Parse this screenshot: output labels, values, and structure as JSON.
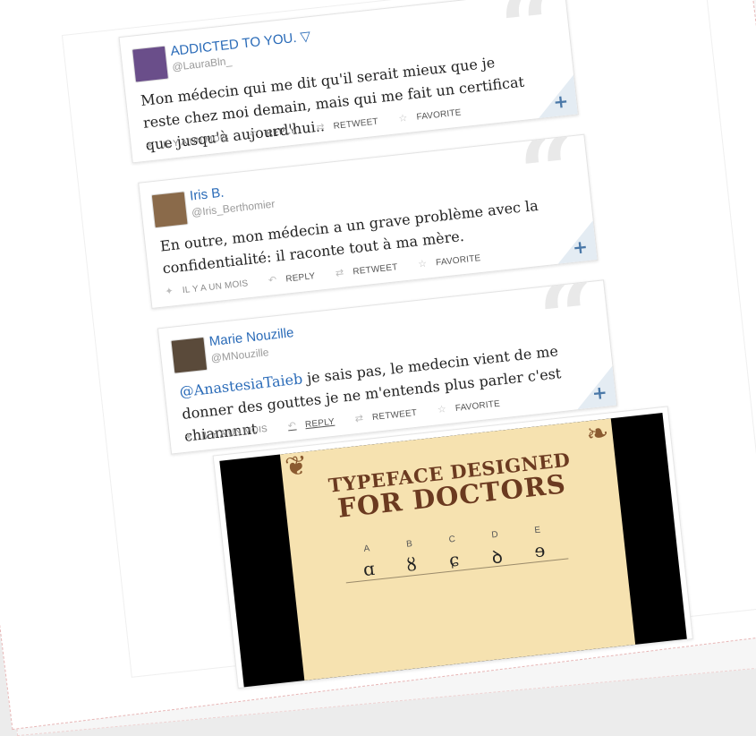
{
  "tweets": [
    {
      "name": "ADDICTED TO YOU. ▽",
      "handle": "@LauraBln_",
      "mention": "",
      "text": "Mon médecin qui me dit qu'il serait mieux que je reste chez moi demain, mais qui me fait un certificat que jusqu'à aujourd'hui..",
      "time": "IL Y A UN MOIS",
      "reply": "REPLY",
      "retweet": "RETWEET",
      "favorite": "FAVORITE",
      "avatar_color": "#6a4e8a"
    },
    {
      "name": "Iris B.",
      "handle": "@Iris_Berthomier",
      "mention": "",
      "text": "En outre, mon médecin a un grave problème avec la confidentialité: il raconte tout à ma mère.",
      "time": "IL Y A UN MOIS",
      "reply": "REPLY",
      "retweet": "RETWEET",
      "favorite": "FAVORITE",
      "avatar_color": "#8a6a4a"
    },
    {
      "name": "Marie Nouzille",
      "handle": "@MNouzille",
      "mention": "@AnastesiaTaieb",
      "text": " je sais pas, le medecin vient de me donner des gouttes je ne m'entends plus parler c'est chiannnnt",
      "time": "IL Y A UN MOIS",
      "reply": "REPLY",
      "retweet": "RETWEET",
      "favorite": "FAVORITE",
      "avatar_color": "#5a4a3a"
    }
  ],
  "media": {
    "title_line1": "TYPEFACE DESIGNED",
    "title_line2": "FOR DOCTORS",
    "letters": [
      {
        "cap": "A",
        "glyph": "ɑ"
      },
      {
        "cap": "B",
        "glyph": "ȣ"
      },
      {
        "cap": "C",
        "glyph": "ɕ"
      },
      {
        "cap": "D",
        "glyph": "ꝺ"
      },
      {
        "cap": "E",
        "glyph": "ɘ"
      }
    ]
  },
  "colors": {
    "link": "#2a6bb8",
    "poster_bg": "#f6e2b0",
    "poster_text": "#6b3a20"
  },
  "icons": {
    "quote": "quote-icon",
    "plus": "plus-icon",
    "bird": "twitter-bird-icon",
    "reply": "reply-icon",
    "retweet": "retweet-icon",
    "favorite": "star-icon"
  }
}
